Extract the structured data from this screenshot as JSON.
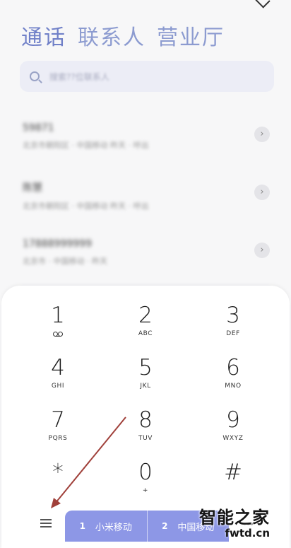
{
  "tabs": [
    {
      "label": "通话"
    },
    {
      "label": "联系人"
    },
    {
      "label": "营业厅"
    }
  ],
  "search": {
    "placeholder": "搜索??位联系人"
  },
  "calls": [
    {
      "name": "59871",
      "meta": "北京市朝阳区 · 中国移动 昨天 · 呼出",
      "info": "›"
    },
    {
      "name": "陈慧",
      "meta": "北京市朝阳区 · 中国移动 昨天 · 呼出",
      "info": "›"
    },
    {
      "name": "17888999999",
      "meta": "北京市 · 中国移动 · 昨天",
      "info": "›"
    }
  ],
  "keys": [
    {
      "digit": "1",
      "letters": ""
    },
    {
      "digit": "2",
      "letters": "ABC"
    },
    {
      "digit": "3",
      "letters": "DEF"
    },
    {
      "digit": "4",
      "letters": "GHI"
    },
    {
      "digit": "5",
      "letters": "JKL"
    },
    {
      "digit": "6",
      "letters": "MNO"
    },
    {
      "digit": "7",
      "letters": "PQRS"
    },
    {
      "digit": "8",
      "letters": "TUV"
    },
    {
      "digit": "9",
      "letters": "WXYZ"
    },
    {
      "digit": "*",
      "letters": ""
    },
    {
      "digit": "0",
      "letters": "+"
    },
    {
      "digit": "#",
      "letters": ""
    }
  ],
  "sim": [
    {
      "slot": "1",
      "label": "小米移动"
    },
    {
      "slot": "2",
      "label": "中国移动"
    }
  ],
  "icons": {
    "voicemail": "voicemail-icon",
    "menu": "menu-icon",
    "dialpad_toggle": "dialpad-grid-icon",
    "search": "search-icon"
  },
  "colors": {
    "accent": "#8d97e6",
    "tab_text": "#8c9bd0",
    "annotation_arrow": "#a0403a"
  },
  "watermark": {
    "title": "智能之家",
    "url": "fwtd.cn"
  }
}
